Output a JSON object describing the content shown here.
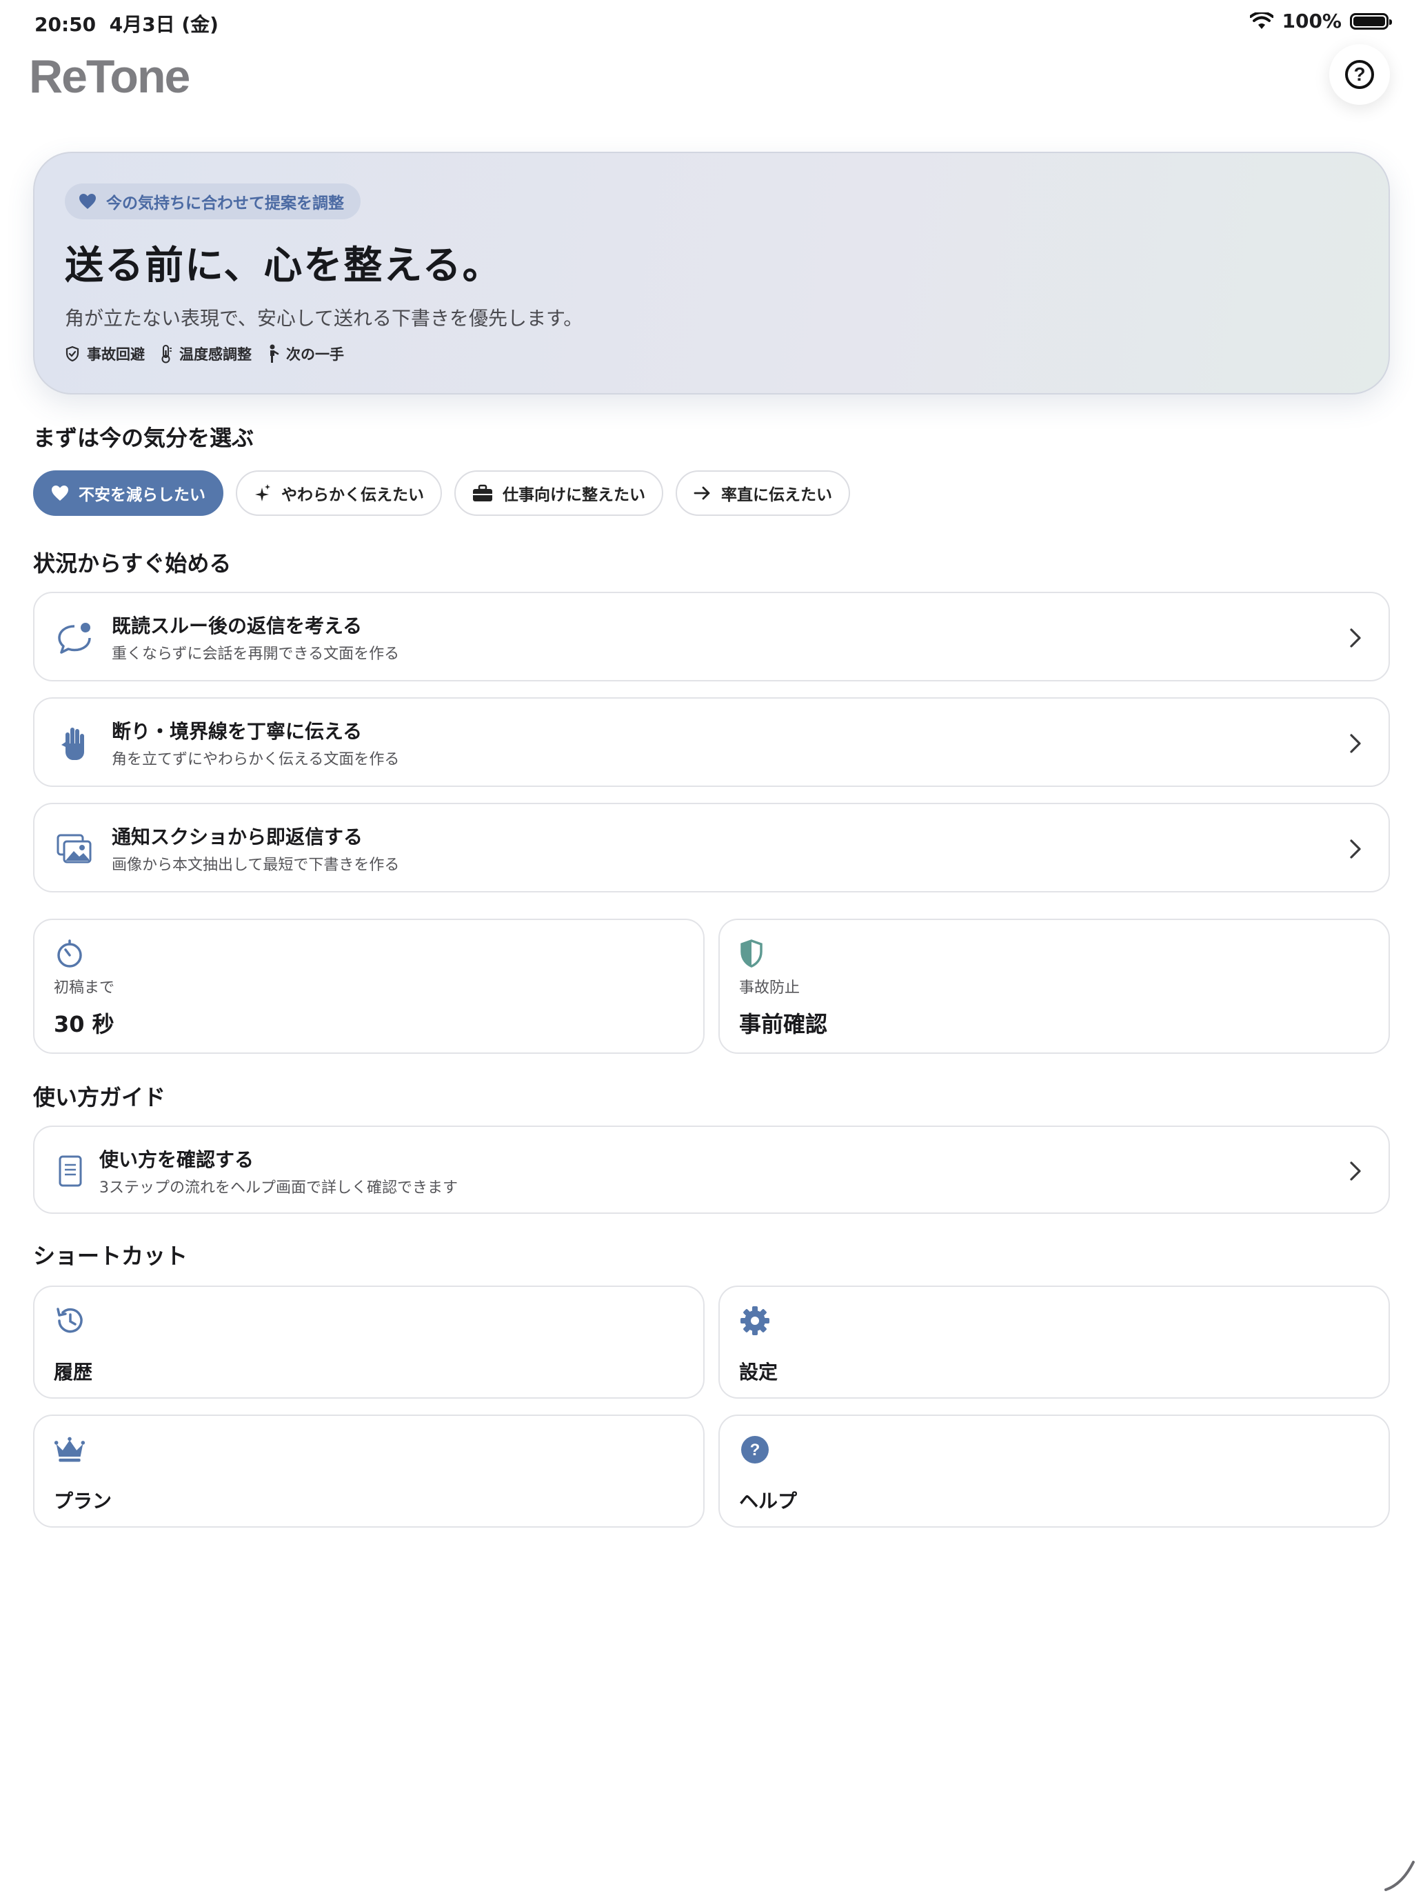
{
  "status": {
    "time": "20:50",
    "date": "4月3日 (金)",
    "battery": "100%"
  },
  "app": {
    "title": "ReTone"
  },
  "hero": {
    "pill": "今の気持ちに合わせて提案を調整",
    "title": "送る前に、心を整える。",
    "subtitle": "角が立たない表現で、安心して送れる下書きを優先します。",
    "tags": [
      "事故回避",
      "温度感調整",
      "次の一手"
    ]
  },
  "mood_section": {
    "title": "まずは今の気分を選ぶ",
    "options": [
      {
        "label": "不安を減らしたい",
        "icon": "heart-icon",
        "selected": true
      },
      {
        "label": "やわらかく伝えたい",
        "icon": "sparkle-icon",
        "selected": false
      },
      {
        "label": "仕事向けに整えたい",
        "icon": "briefcase-icon",
        "selected": false
      },
      {
        "label": "率直に伝えたい",
        "icon": "arrow-right-icon",
        "selected": false
      }
    ]
  },
  "situations": {
    "title": "状況からすぐ始める",
    "items": [
      {
        "title": "既読スルー後の返信を考える",
        "subtitle": "重くならずに会話を再開できる文面を作る",
        "icon": "chat-bubble-icon"
      },
      {
        "title": "断り・境界線を丁寧に伝える",
        "subtitle": "角を立てずにやわらかく伝える文面を作る",
        "icon": "hand-icon"
      },
      {
        "title": "通知スクショから即返信する",
        "subtitle": "画像から本文抽出して最短で下書きを作る",
        "icon": "photos-icon"
      }
    ]
  },
  "stats": [
    {
      "label": "初稿まで",
      "value": "30 秒",
      "icon": "timer-icon"
    },
    {
      "label": "事故防止",
      "value": "事前確認",
      "icon": "shield-icon"
    }
  ],
  "guide": {
    "title": "使い方ガイド",
    "item": {
      "title": "使い方を確認する",
      "subtitle": "3ステップの流れをヘルプ画面で詳しく確認できます",
      "icon": "document-icon"
    }
  },
  "shortcuts": {
    "title": "ショートカット",
    "items": [
      {
        "label": "履歴",
        "icon": "history-icon"
      },
      {
        "label": "設定",
        "icon": "gear-icon"
      },
      {
        "label": "プラン",
        "icon": "crown-icon"
      },
      {
        "label": "ヘルプ",
        "icon": "help-circle-icon"
      }
    ]
  },
  "colors": {
    "accent": "#5577AB",
    "shield": "#5E9A92",
    "background": "#FFFFFF"
  }
}
